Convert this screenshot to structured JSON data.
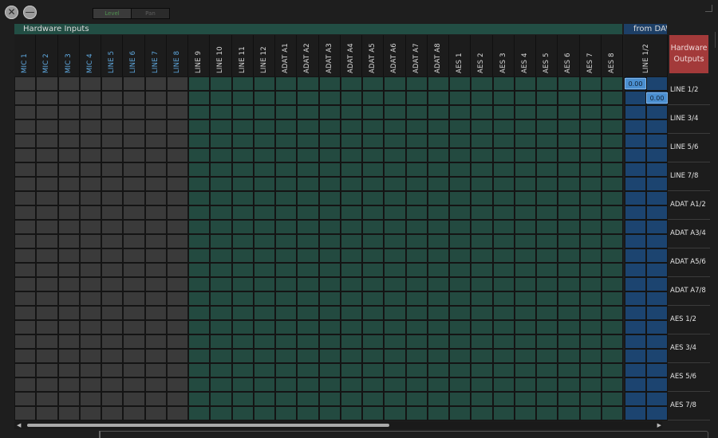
{
  "window_buttons": {
    "close": "✕",
    "minimize": "—"
  },
  "top_toggles": {
    "level": "Level",
    "pan": "Pan"
  },
  "sections": {
    "hardware_inputs": "Hardware Inputs",
    "from_daw": "from DAW",
    "hardware_outputs": "Hardware Outputs"
  },
  "input_columns": [
    "MIC 1",
    "MIC 2",
    "MIC 3",
    "MIC 4",
    "LINE 5",
    "LINE 6",
    "LINE 7",
    "LINE 8",
    "LINE 9",
    "LINE 10",
    "LINE 11",
    "LINE 12",
    "ADAT A1",
    "ADAT A2",
    "ADAT A3",
    "ADAT A4",
    "ADAT A5",
    "ADAT A6",
    "ADAT A7",
    "ADAT A8",
    "AES 1",
    "AES 2",
    "AES 3",
    "AES 4",
    "AES 5",
    "AES 6",
    "AES 7",
    "AES 8"
  ],
  "daw_columns": [
    "LINE 1/2"
  ],
  "output_rows": [
    "LINE 1/2",
    "LINE 3/4",
    "LINE 5/6",
    "LINE 7/8",
    "ADAT A1/2",
    "ADAT A3/4",
    "ADAT A5/6",
    "ADAT A7/8",
    "AES 1/2",
    "AES 3/4",
    "AES 5/6",
    "AES 7/8"
  ],
  "gains": {
    "daw_line12_left": "0.00",
    "daw_line12_right": "0.00"
  },
  "colors": {
    "mic_line_column_label": "#5fa9e0",
    "analog_input_cells": "#3a3a3a",
    "digital_input_cells": "#234a40",
    "daw_cells": "#1c4470",
    "hardware_outputs_header": "#a33a3a",
    "gain_box": "#4b8fd0"
  }
}
